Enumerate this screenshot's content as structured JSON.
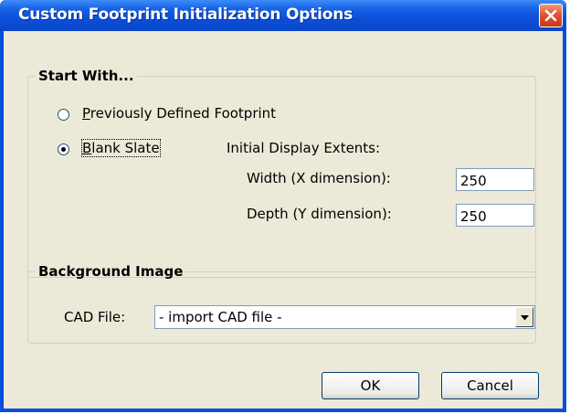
{
  "window": {
    "title": "Custom Footprint Initialization Options"
  },
  "start_with": {
    "legend": "Start With...",
    "option_previous": {
      "mnemonic": "P",
      "rest": "reviously Defined Footprint",
      "selected": false
    },
    "option_blank": {
      "mnemonic": "B",
      "rest": "lank Slate",
      "selected": true
    },
    "extents_label": "Initial Display Extents:",
    "width_label": "Width (X dimension):",
    "width_value": "250",
    "depth_label": "Depth (Y dimension):",
    "depth_value": "250"
  },
  "background_image": {
    "legend": "Background Image",
    "cad_label": "CAD File:",
    "cad_selected": "- import CAD file -"
  },
  "buttons": {
    "ok": "OK",
    "cancel": "Cancel"
  },
  "icons": {
    "close": "close-icon",
    "dropdown": "chevron-down-icon"
  },
  "colors": {
    "titlebar": "#0a4fd8",
    "dialog_bg": "#ece9d8",
    "close_button": "#e0502b"
  }
}
